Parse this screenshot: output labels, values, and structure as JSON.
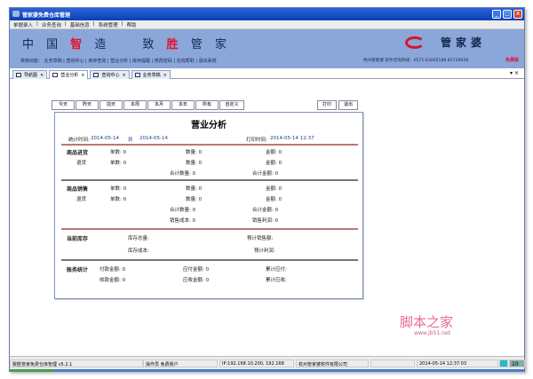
{
  "window": {
    "title": "管家婆免费仓库管理",
    "minimize": "_",
    "maximize": "□",
    "close": "×"
  },
  "menu": [
    "单据录入",
    "|",
    "业务查询",
    "|",
    "基础信息",
    "|",
    "系统管理",
    "|",
    "帮助"
  ],
  "banner": {
    "slogan_parts": [
      "中 国 ",
      "智",
      " 造　　致 ",
      "胜",
      " 管 家"
    ],
    "quick": "常用功能： 业务草稿 | 查询中心 | 库存查询 | 营业分析 | 库存提醒 | 修改密码 | 在线帮助 | 退出系统",
    "brand": "管家婆",
    "hotline": "杭州管家婆  软件咨询热线：0571-63065188  82739828",
    "free": "免费版"
  },
  "tabs": [
    {
      "label": "导航图",
      "close": "×"
    },
    {
      "label": "营业分析",
      "close": "×"
    },
    {
      "label": "查询中心",
      "close": "×"
    },
    {
      "label": "业务草稿",
      "close": "×"
    }
  ],
  "tab_controls": "▾ ×",
  "range_buttons": [
    "今天",
    "昨天",
    "前天",
    "本周",
    "本月",
    "本年",
    "所有",
    "自定义"
  ],
  "print": "打印",
  "exit": "退出",
  "report": {
    "title": "营业分析",
    "period_label": "统计时间:",
    "start": "2014-05-14",
    "to": "到",
    "end": "2014-05-14",
    "print_label": "打印时间:",
    "print_time": "2014-05-14 12:37",
    "purchase": {
      "title": "商品进货",
      "return": "退货",
      "rows": [
        "单数: 0",
        "数量: 0",
        "金额: 0",
        "单数: 0",
        "数量: 0",
        "金额: 0",
        "合计数量: 0",
        "合计金额: 0"
      ]
    },
    "sales": {
      "title": "商品销售",
      "return": "退货",
      "rows": [
        "单数: 0",
        "数量: 0",
        "金额: 0",
        "单数: 0",
        "数量: 0",
        "金额: 0",
        "合计数量: 0",
        "合计金额: 0",
        "销售成本: 0",
        "销售利润: 0"
      ]
    },
    "stock": {
      "title": "当前库存",
      "rows": [
        "库存总量:",
        "预计销售额:",
        "库存成本:",
        "预计利润:"
      ]
    },
    "accounts": {
      "title": "账务统计",
      "rows": [
        "付款金额: 0",
        "应付金额: 0",
        "累计应付:",
        "收款金额: 0",
        "应收金额: 0",
        "累计应收:"
      ]
    }
  },
  "status": {
    "app": "致胜管家免费仓库管理 v5.2.1",
    "operator": "操作员  免费账户",
    "ip": "IP:192.168.10.200, 192.168",
    "company": "杭州管家婆软件有限公司",
    "blank": "",
    "time": "2014-05-14 12:37:03",
    "num": "10"
  },
  "watermark": {
    "cn": "脚本之家",
    "url": "www.jb51.net"
  }
}
